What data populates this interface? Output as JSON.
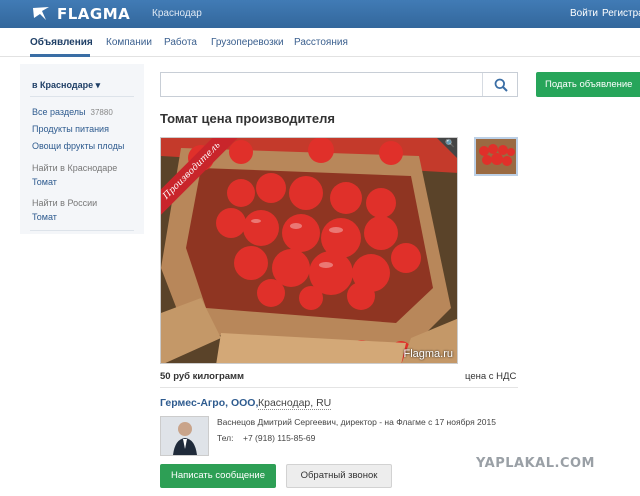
{
  "header": {
    "logo_text": "FLAGMA",
    "city": "Краснодар",
    "login": "Войти",
    "register": "Регистрация"
  },
  "nav": {
    "items": [
      "Объявления",
      "Компании",
      "Работа",
      "Грузоперевозки",
      "Расстояния"
    ],
    "active_index": 0
  },
  "sidebar": {
    "region_selector": "в Краснодаре ▾",
    "all_sections": "Все разделы",
    "all_sections_count": "37880",
    "crumbs": [
      "Продукты питания",
      "Овощи фрукты плоды"
    ],
    "find_local_label": "Найти в Краснодаре",
    "find_local_value": "Томат",
    "find_russia_label": "Найти в России",
    "find_russia_value": "Томат"
  },
  "search": {
    "value": "",
    "placeholder": "",
    "button_icon": "search-icon"
  },
  "post_button": "Подать объявление",
  "listing": {
    "title": "Томат цена производителя",
    "photo_badge": "Производитель",
    "photo_watermark": "Flagma.ru",
    "zoom_icon": "🔍",
    "price": "50 руб килограмм",
    "vat": "цена с НДС",
    "company_name": "Гермес-Агро, ООО,",
    "company_city": "Краснодар, RU",
    "contact_person": "Васнецов Дмитрий Сергеевич, директор - на Флагме с 17 ноября 2015",
    "phone_label": "Тел:",
    "phone_value": "+7 (918) 115-85-69",
    "message_button": "Написать сообщение",
    "callback_button": "Обратный звонок"
  },
  "site_watermark": "YAPLAKAL.COM",
  "colors": {
    "header_bg": "#3a6ea5",
    "accent_green": "#27a55a",
    "link_blue": "#2e5b8f"
  }
}
